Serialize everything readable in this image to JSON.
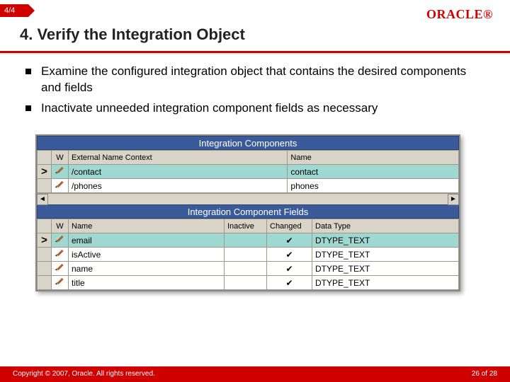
{
  "tab": "4/4",
  "logo": "ORACLE",
  "title": "4. Verify the Integration Object",
  "bullets": [
    "Examine the configured integration object that contains the desired components and fields",
    "Inactivate unneeded integration component fields as necessary"
  ],
  "panel1": {
    "title": "Integration Components",
    "headers": {
      "w": "W",
      "ext": "External Name Context",
      "name": "Name"
    },
    "rows": [
      {
        "selected": true,
        "ext": "/contact",
        "name": "contact"
      },
      {
        "selected": false,
        "ext": "/phones",
        "name": "phones"
      }
    ]
  },
  "panel2": {
    "title": "Integration Component Fields",
    "headers": {
      "w": "W",
      "name": "Name",
      "inactive": "Inactive",
      "changed": "Changed",
      "dtype": "Data Type"
    },
    "rows": [
      {
        "selected": true,
        "name": "email",
        "inactive": "",
        "changed": "✔",
        "dtype": "DTYPE_TEXT"
      },
      {
        "selected": false,
        "name": "isActive",
        "inactive": "",
        "changed": "✔",
        "dtype": "DTYPE_TEXT"
      },
      {
        "selected": false,
        "name": "name",
        "inactive": "",
        "changed": "✔",
        "dtype": "DTYPE_TEXT"
      },
      {
        "selected": false,
        "name": "title",
        "inactive": "",
        "changed": "✔",
        "dtype": "DTYPE_TEXT"
      }
    ]
  },
  "hscroll": {
    "left": "◄",
    "right": "►"
  },
  "footer": {
    "copyright": "Copyright © 2007, Oracle. All rights reserved.",
    "page": "26 of 28"
  }
}
